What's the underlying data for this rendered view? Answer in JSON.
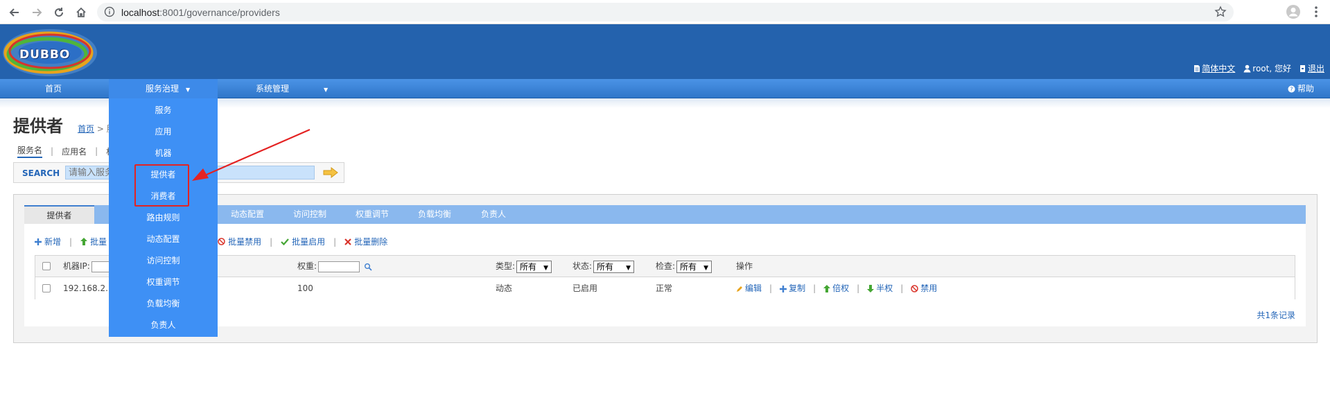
{
  "browser": {
    "url_host": "localhost",
    "url_rest": ":8001/governance/providers",
    "icons": [
      "back-arrow-icon",
      "forward-arrow-icon",
      "reload-icon",
      "home-icon",
      "info-icon",
      "star-icon",
      "profile-icon",
      "menu-dots-icon"
    ]
  },
  "header": {
    "logo_text": "DUBBO",
    "lang_label": "简体中文",
    "user_label": "root, 您好",
    "logout_label": "退出"
  },
  "mainnav": {
    "home": "首页",
    "governance": "服务治理",
    "system": "系统管理",
    "help": "帮助"
  },
  "dropdown": {
    "items": [
      "服务",
      "应用",
      "机器",
      "提供者",
      "消费者",
      "路由规则",
      "动态配置",
      "访问控制",
      "权重调节",
      "负载均衡",
      "负责人"
    ]
  },
  "page": {
    "title": "提供者",
    "breadcrumb_home": "首页",
    "breadcrumb_rest": " > 服",
    "search_tabs": [
      "服务名",
      "应用名",
      "机"
    ],
    "search_label": "SEARCH",
    "search_placeholder": "请输入服务名"
  },
  "tabs": [
    "提供者",
    "动态配置",
    "访问控制",
    "权重调节",
    "负载均衡",
    "负责人"
  ],
  "toolbar": {
    "add": "新增",
    "batch": "批量",
    "batch_disable": "批量禁用",
    "batch_enable": "批量启用",
    "batch_delete": "批量删除"
  },
  "table": {
    "headers": {
      "ip": "机器IP:",
      "weight": "权重:",
      "type": "类型:",
      "status": "状态:",
      "check": "检查:",
      "ops": "操作"
    },
    "filter_values": {
      "type": "所有",
      "status": "所有",
      "check": "所有"
    },
    "rows": [
      {
        "ip": "192.168.2.1",
        "weight": "100",
        "type": "动态",
        "status": "已启用",
        "check": "正常",
        "ops": [
          "编辑",
          "复制",
          "倍权",
          "半权",
          "禁用"
        ]
      }
    ],
    "total": "共1条记录"
  },
  "colors": {
    "header_bg": "#2462ad",
    "nav_bg": "#3a82d8",
    "dropdown_bg": "#3e90f5",
    "tabbar_bg": "#8ab8ee",
    "highlight_red": "#e42222",
    "link_blue": "#2466b8",
    "status_green": "#2b8a2b"
  }
}
